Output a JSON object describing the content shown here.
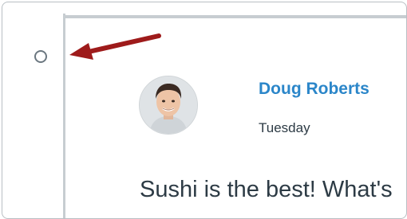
{
  "reply": {
    "author_name": "Doug Roberts",
    "date": "Tuesday",
    "message": "Sushi is the best! What's"
  },
  "icons": {
    "unread": "unread-circle-icon",
    "avatar": "user-avatar",
    "pointer": "red-arrow-icon"
  },
  "colors": {
    "author_link": "#2b86c9",
    "arrow": "#9e1b1b",
    "text": "#2d3b45",
    "rule": "#c7cdd1"
  }
}
